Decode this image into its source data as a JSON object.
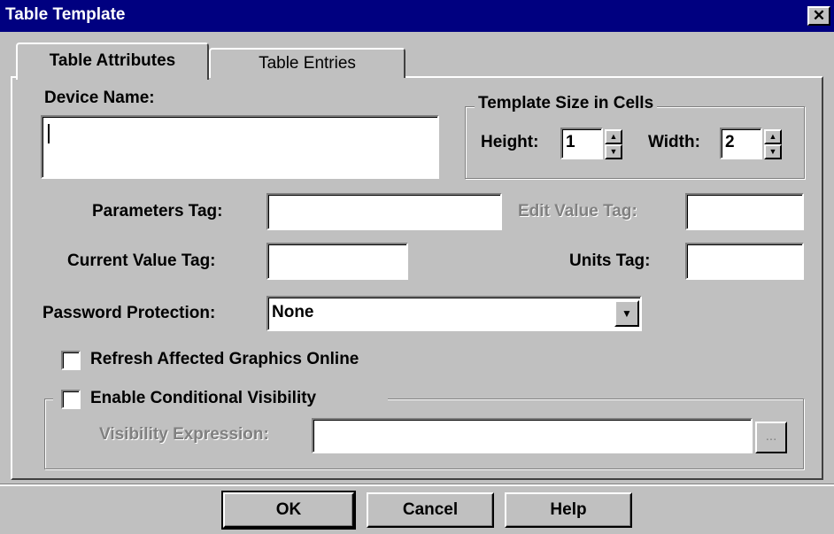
{
  "window": {
    "title": "Table Template",
    "close_glyph": "✕"
  },
  "tabs": [
    {
      "label": "Table Attributes",
      "active": true
    },
    {
      "label": "Table Entries",
      "active": false
    }
  ],
  "device_name": {
    "label": "Device Name:",
    "value": ""
  },
  "template_size": {
    "group_title": "Template Size in Cells",
    "height_label": "Height:",
    "height_value": "1",
    "width_label": "Width:",
    "width_value": "2"
  },
  "parameters_tag": {
    "label": "Parameters Tag:",
    "value": ""
  },
  "edit_value_tag": {
    "label": "Edit Value Tag:",
    "value": "",
    "enabled": false
  },
  "current_value_tag": {
    "label": "Current Value Tag:",
    "value": ""
  },
  "units_tag": {
    "label": "Units Tag:",
    "value": ""
  },
  "password_protection": {
    "label": "Password Protection:",
    "selected": "None"
  },
  "refresh_graphics": {
    "label": "Refresh Affected Graphics Online",
    "checked": false
  },
  "conditional_visibility": {
    "label": "Enable Conditional Visibility",
    "checked": false,
    "expression_label": "Visibility Expression:",
    "expression_value": "",
    "browse_label": "..."
  },
  "buttons": {
    "ok": "OK",
    "cancel": "Cancel",
    "help": "Help"
  },
  "colors": {
    "titlebar": "#000080",
    "face": "#c0c0c0",
    "disabled_text": "#808080"
  }
}
